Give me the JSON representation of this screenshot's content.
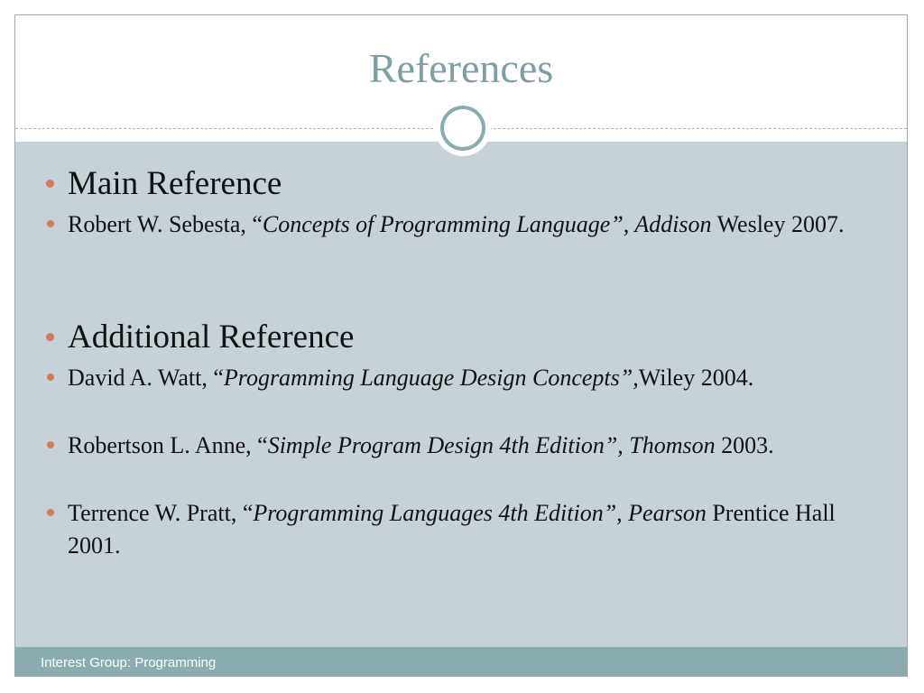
{
  "slide": {
    "title": "References",
    "sections": [
      {
        "heading": "Main Reference",
        "refs": [
          {
            "author": "Robert W. Sebesta, “",
            "italic": "Concepts of Programming Language”, Addison",
            "tail": " Wesley 2007."
          }
        ]
      },
      {
        "heading": "Additional Reference",
        "refs": [
          {
            "author": "David A. Watt, “",
            "italic": "Programming Language Design Concepts”,",
            "tail": "Wiley 2004."
          },
          {
            "author": "Robertson L. Anne, “",
            "italic": "Simple Program Design 4th Edition”, Thomson",
            "tail": " 2003."
          },
          {
            "author": "Terrence W. Pratt, “",
            "italic": "Programming Languages 4th Edition”, Pearson",
            "tail": " Prentice Hall 2001."
          }
        ]
      }
    ],
    "footer": "Interest Group: Programming",
    "colors": {
      "title": "#7f9ea3",
      "body_background": "#c6d1d8",
      "bullet": "#d6775e",
      "footer_bar": "#8aacaf"
    }
  }
}
